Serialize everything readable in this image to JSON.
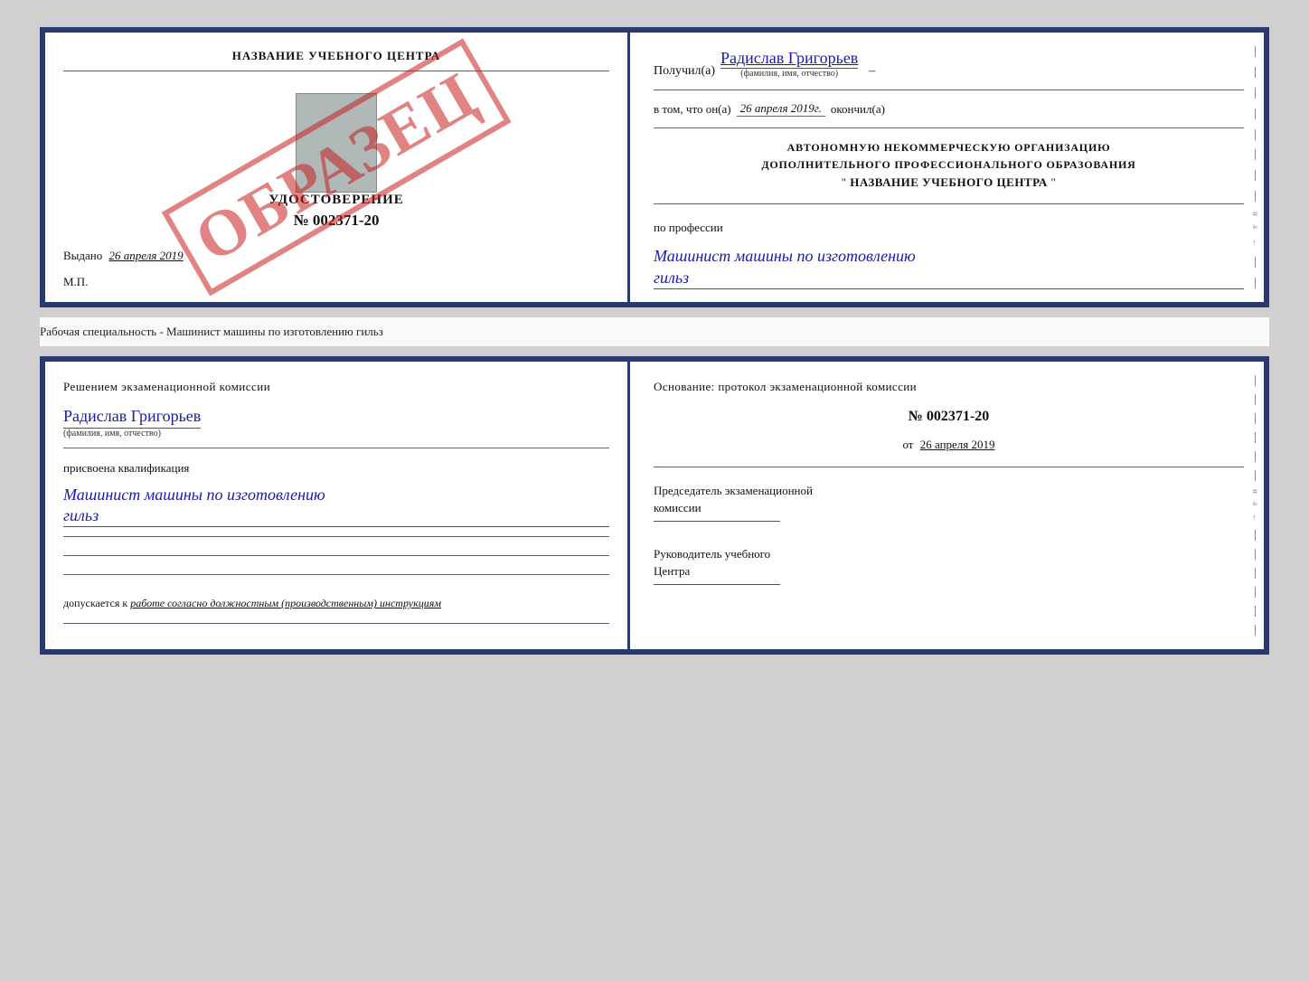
{
  "upper": {
    "left": {
      "center_name": "НАЗВАНИЕ УЧЕБНОГО ЦЕНТРА",
      "udostoverenie_title": "УДОСТОВЕРЕНИЕ",
      "number": "№ 002371-20",
      "vydano": "Выдано",
      "vydano_date": "26 апреля 2019",
      "mp": "М.П."
    },
    "stamp": "ОБРАЗЕЦ",
    "right": {
      "poluchil": "Получил(а)",
      "name": "Радислав Григорьев",
      "fio_subtitle": "(фамилия, имя, отчество)",
      "dash": "–",
      "vtom": "в том, что он(а)",
      "date": "26 апреля 2019г.",
      "okonchil": "окончил(а)",
      "org_line1": "АВТОНОМНУЮ НЕКОММЕРЧЕСКУЮ ОРГАНИЗАЦИЮ",
      "org_line2": "ДОПОЛНИТЕЛЬНОГО ПРОФЕССИОНАЛЬНОГО ОБРАЗОВАНИЯ",
      "org_quote_start": "\"",
      "org_center_name": "НАЗВАНИЕ УЧЕБНОГО ЦЕНТРА",
      "org_quote_end": "\"",
      "po_professii": "по профессии",
      "professiya": "Машинист машины по изготовлению",
      "professiya2": "гильз"
    }
  },
  "specialty_line": "Рабочая специальность - Машинист машины по изготовлению гильз",
  "lower": {
    "left": {
      "resheniem": "Решением  экзаменационной  комиссии",
      "name": "Радислав Григорьев",
      "fio_subtitle": "(фамилия, имя, отчество)",
      "prisvoena": "присвоена квалификация",
      "qualification": "Машинист машины по изготовлению",
      "qualification2": "гильз",
      "dopuskaetsya": "допускается к",
      "dopuskaetsya_italic": "работе согласно должностным (производственным) инструкциям"
    },
    "right": {
      "osnovanie": "Основание: протокол экзаменационной  комиссии",
      "number": "№  002371-20",
      "ot": "от",
      "date": "26 апреля 2019",
      "predsedatel_title": "Председатель экзаменационной",
      "predsedatel_sub": "комиссии",
      "rukovoditel_title": "Руководитель учебного",
      "rukovoditel_sub": "Центра"
    }
  }
}
